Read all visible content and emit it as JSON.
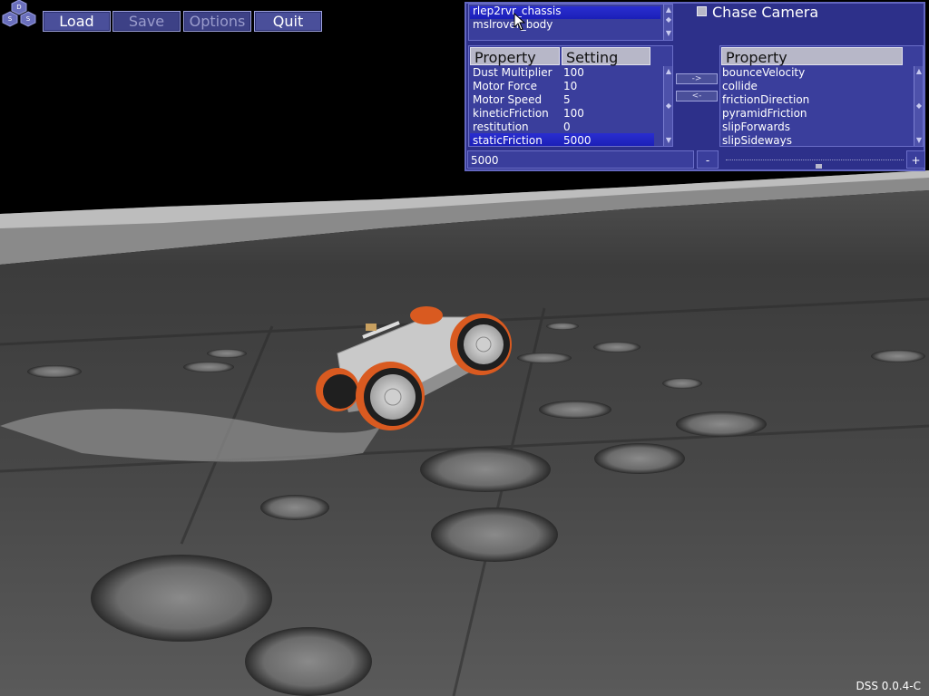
{
  "logo": {
    "letters": [
      "D",
      "S",
      "S"
    ]
  },
  "menu": {
    "load": "Load",
    "save": "Save",
    "options": "Options",
    "quit": "Quit"
  },
  "bodies": {
    "items": [
      "rlep2rvr_chassis",
      "mslrover_body"
    ],
    "selected": "rlep2rvr_chassis"
  },
  "chase_camera": {
    "label": "Chase Camera",
    "checked": false
  },
  "properties": {
    "header_property": "Property",
    "header_setting": "Setting",
    "rows": [
      {
        "name": "Dust Multiplier",
        "value": "100"
      },
      {
        "name": "Motor Force",
        "value": "10"
      },
      {
        "name": "Motor Speed",
        "value": "5"
      },
      {
        "name": "kineticFriction",
        "value": "100"
      },
      {
        "name": "restitution",
        "value": "0"
      },
      {
        "name": "staticFriction",
        "value": "5000"
      }
    ],
    "selected": "staticFriction"
  },
  "available": {
    "header": "Property",
    "rows": [
      "bounceVelocity",
      "collide",
      "frictionDirection",
      "pyramidFriction",
      "slipForwards",
      "slipSideways"
    ]
  },
  "transfer": {
    "add": "->",
    "remove": "<-"
  },
  "value_field": {
    "value": "5000"
  },
  "slider": {
    "minus": "-",
    "plus": "+",
    "level": 0.52
  },
  "footer": {
    "version": "DSS 0.0.4-C"
  }
}
